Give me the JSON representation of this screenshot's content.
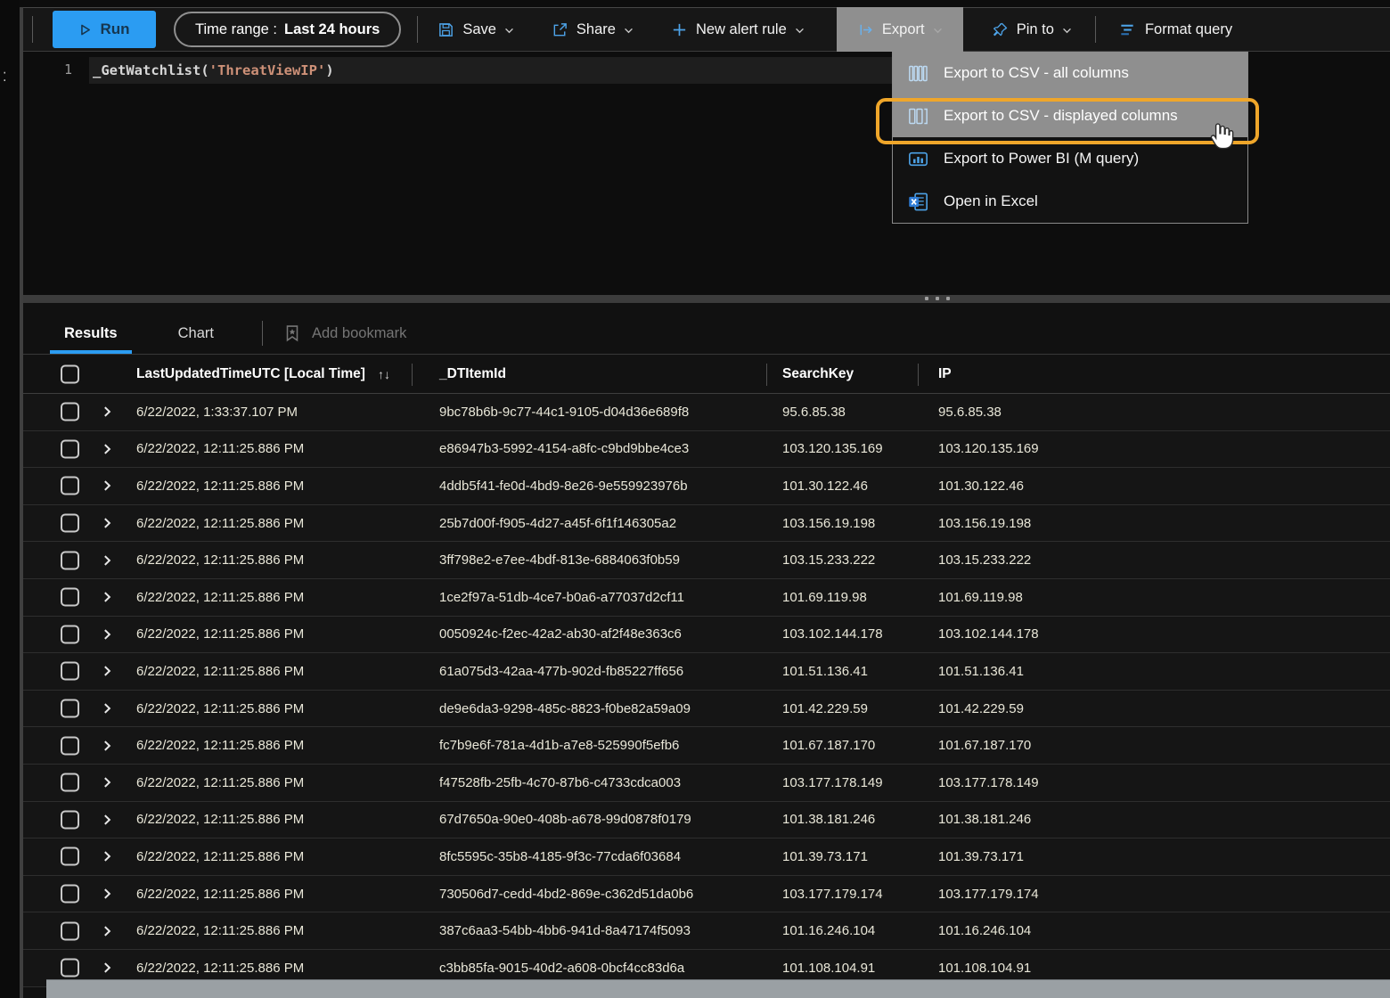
{
  "toolbar": {
    "run_label": "Run",
    "time_range_label": "Time range :",
    "time_range_value": "Last 24 hours",
    "save_label": "Save",
    "share_label": "Share",
    "new_alert_rule_label": "New alert rule",
    "export_label": "Export",
    "pin_to_label": "Pin to",
    "format_query_label": "Format query"
  },
  "editor": {
    "line_number": "1",
    "code_function": "_GetWatchlist(",
    "code_string": "'ThreatViewIP'",
    "code_close": ")"
  },
  "export_menu": {
    "highlight_color": "#efa62a",
    "items": [
      {
        "label": "Export to CSV - all columns",
        "icon": "columns-all-icon"
      },
      {
        "label": "Export to CSV - displayed columns",
        "icon": "columns-displayed-icon",
        "highlighted": true
      },
      {
        "label": "Export to Power BI (M query)",
        "icon": "power-bi-icon"
      },
      {
        "label": "Open in Excel",
        "icon": "excel-icon"
      }
    ]
  },
  "results": {
    "tabs": {
      "results_label": "Results",
      "chart_label": "Chart"
    },
    "add_bookmark_label": "Add bookmark",
    "table": {
      "columns": {
        "time": "LastUpdatedTimeUTC [Local Time]",
        "item_id": "_DTItemId",
        "search_key": "SearchKey",
        "ip": "IP"
      },
      "sort_icon": "↑↓",
      "rows": [
        {
          "time": "6/22/2022, 1:33:37.107 PM",
          "item_id": "9bc78b6b-9c77-44c1-9105-d04d36e689f8",
          "search_key": "95.6.85.38",
          "ip": "95.6.85.38"
        },
        {
          "time": "6/22/2022, 12:11:25.886 PM",
          "item_id": "e86947b3-5992-4154-a8fc-c9bd9bbe4ce3",
          "search_key": "103.120.135.169",
          "ip": "103.120.135.169"
        },
        {
          "time": "6/22/2022, 12:11:25.886 PM",
          "item_id": "4ddb5f41-fe0d-4bd9-8e26-9e559923976b",
          "search_key": "101.30.122.46",
          "ip": "101.30.122.46"
        },
        {
          "time": "6/22/2022, 12:11:25.886 PM",
          "item_id": "25b7d00f-f905-4d27-a45f-6f1f146305a2",
          "search_key": "103.156.19.198",
          "ip": "103.156.19.198"
        },
        {
          "time": "6/22/2022, 12:11:25.886 PM",
          "item_id": "3ff798e2-e7ee-4bdf-813e-6884063f0b59",
          "search_key": "103.15.233.222",
          "ip": "103.15.233.222"
        },
        {
          "time": "6/22/2022, 12:11:25.886 PM",
          "item_id": "1ce2f97a-51db-4ce7-b0a6-a77037d2cf11",
          "search_key": "101.69.119.98",
          "ip": "101.69.119.98"
        },
        {
          "time": "6/22/2022, 12:11:25.886 PM",
          "item_id": "0050924c-f2ec-42a2-ab30-af2f48e363c6",
          "search_key": "103.102.144.178",
          "ip": "103.102.144.178"
        },
        {
          "time": "6/22/2022, 12:11:25.886 PM",
          "item_id": "61a075d3-42aa-477b-902d-fb85227ff656",
          "search_key": "101.51.136.41",
          "ip": "101.51.136.41"
        },
        {
          "time": "6/22/2022, 12:11:25.886 PM",
          "item_id": "de9e6da3-9298-485c-8823-f0be82a59a09",
          "search_key": "101.42.229.59",
          "ip": "101.42.229.59"
        },
        {
          "time": "6/22/2022, 12:11:25.886 PM",
          "item_id": "fc7b9e6f-781a-4d1b-a7e8-525990f5efb6",
          "search_key": "101.67.187.170",
          "ip": "101.67.187.170"
        },
        {
          "time": "6/22/2022, 12:11:25.886 PM",
          "item_id": "f47528fb-25fb-4c70-87b6-c4733cdca003",
          "search_key": "103.177.178.149",
          "ip": "103.177.178.149"
        },
        {
          "time": "6/22/2022, 12:11:25.886 PM",
          "item_id": "67d7650a-90e0-408b-a678-99d0878f0179",
          "search_key": "101.38.181.246",
          "ip": "101.38.181.246"
        },
        {
          "time": "6/22/2022, 12:11:25.886 PM",
          "item_id": "8fc5595c-35b8-4185-9f3c-77cda6f03684",
          "search_key": "101.39.73.171",
          "ip": "101.39.73.171"
        },
        {
          "time": "6/22/2022, 12:11:25.886 PM",
          "item_id": "730506d7-cedd-4bd2-869e-c362d51da0b6",
          "search_key": "103.177.179.174",
          "ip": "103.177.179.174"
        },
        {
          "time": "6/22/2022, 12:11:25.886 PM",
          "item_id": "387c6aa3-54bb-4bb6-941d-8a47174f5093",
          "search_key": "101.16.246.104",
          "ip": "101.16.246.104"
        },
        {
          "time": "6/22/2022, 12:11:25.886 PM",
          "item_id": "c3bb85fa-9015-40d2-a608-0bcf4cc83d6a",
          "search_key": "101.108.104.91",
          "ip": "101.108.104.91"
        }
      ]
    }
  },
  "colors": {
    "accent_blue": "#2b9cf2",
    "icon_blue": "#4da3e8",
    "highlight_orange": "#efa62a",
    "menu_gray": "#8f8f8f",
    "string_token": "#ce9178"
  }
}
